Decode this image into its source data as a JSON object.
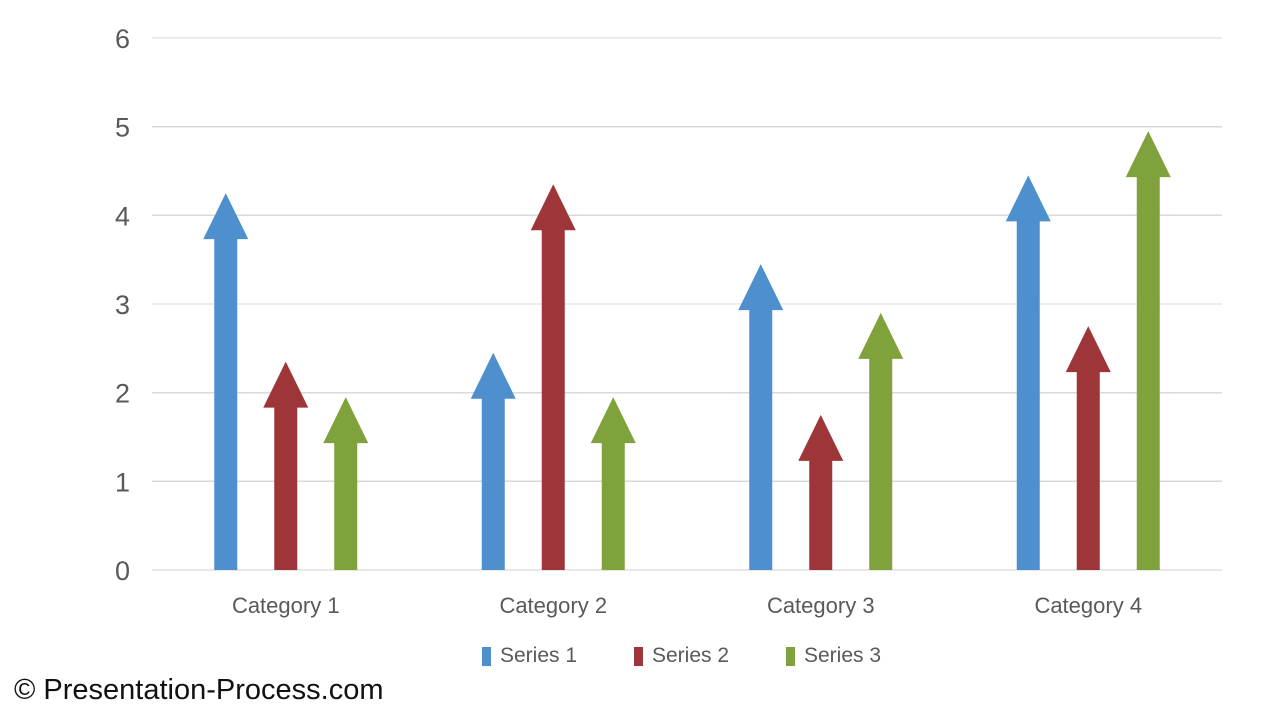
{
  "watermark": {
    "text": "© Presentation-Process.com"
  },
  "axis": {
    "y_ticks": [
      "0",
      "1",
      "2",
      "3",
      "4",
      "5",
      "6"
    ]
  },
  "legend": {
    "items": [
      {
        "label": "Series 1",
        "color": "#4D90CD"
      },
      {
        "label": "Series 2",
        "color": "#9E3539"
      },
      {
        "label": "Series 3",
        "color": "#7FA23C"
      }
    ]
  },
  "chart_data": {
    "type": "bar",
    "title": "",
    "subtitle": "",
    "xlabel": "",
    "ylabel": "",
    "ylim": [
      0,
      6
    ],
    "ytick_step": 1,
    "grid": true,
    "legend_position": "bottom",
    "marker_style": "arrow-columns",
    "categories": [
      "Category 1",
      "Category 2",
      "Category 3",
      "Category 4"
    ],
    "series": [
      {
        "name": "Series 1",
        "color": "#4D90CD",
        "values": [
          4.25,
          2.45,
          3.45,
          4.45
        ]
      },
      {
        "name": "Series 2",
        "color": "#9E3539",
        "values": [
          2.35,
          4.35,
          1.75,
          2.75
        ]
      },
      {
        "name": "Series 3",
        "color": "#7FA23C",
        "values": [
          1.95,
          1.95,
          2.9,
          4.95
        ]
      }
    ]
  }
}
